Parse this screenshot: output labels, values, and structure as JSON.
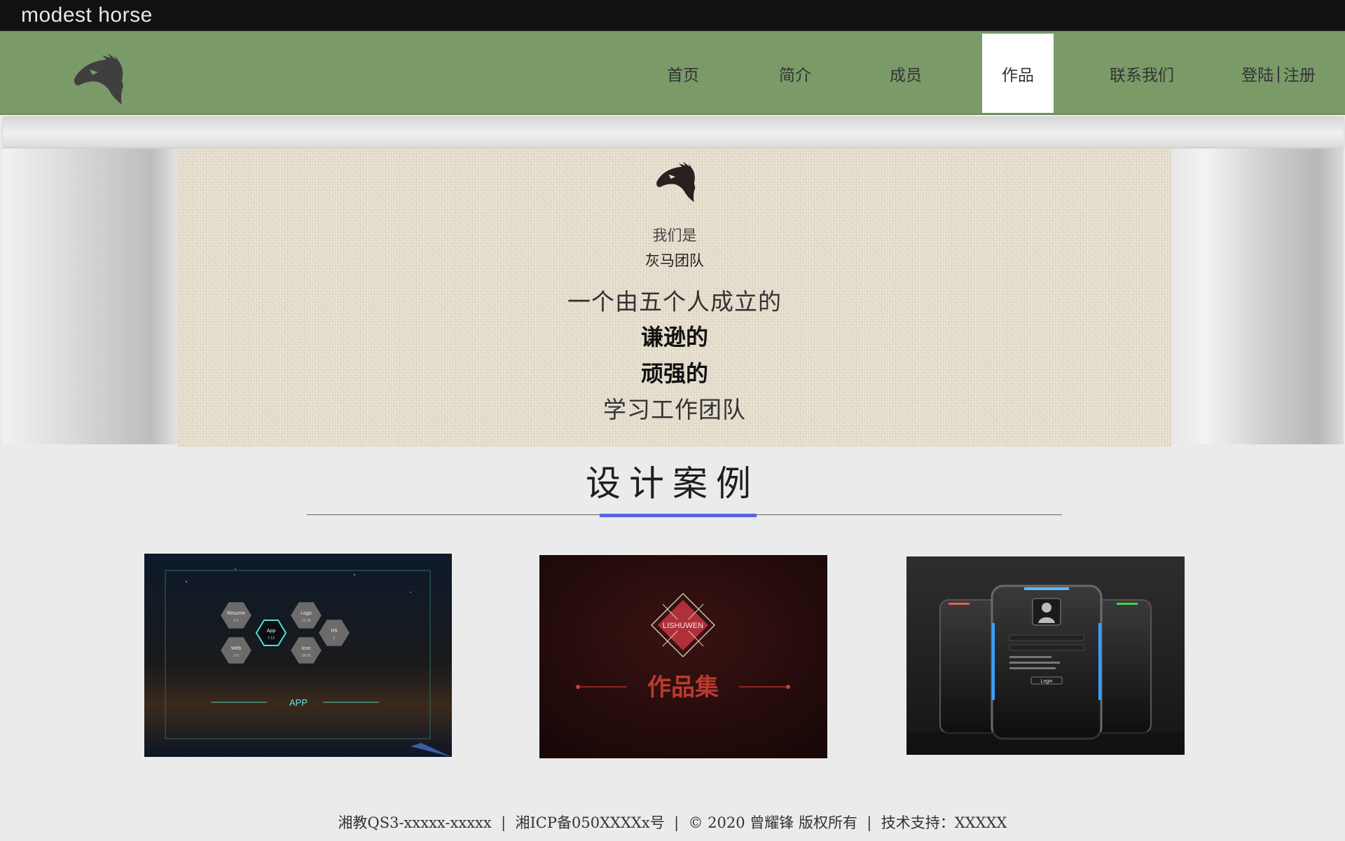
{
  "topbar": {
    "site_name": "modest horse"
  },
  "nav": {
    "logo_icon": "horse-head-icon",
    "items": [
      {
        "label": "首页"
      },
      {
        "label": "简介"
      },
      {
        "label": "成员"
      },
      {
        "label": "作品",
        "active": true
      },
      {
        "label": "联系我们"
      }
    ],
    "login_label": "登陆",
    "separator": "|",
    "register_label": "注册"
  },
  "hero": {
    "logo_icon": "horse-head-icon",
    "line1": "我们是",
    "line2": "灰马团队",
    "line3": "一个由五个人成立的",
    "line4": "谦逊的",
    "line5": "顽强的",
    "line6": "学习工作团队"
  },
  "section": {
    "title": "设计案例",
    "accent_color": "#5b63e0"
  },
  "cases": [
    {
      "hexagons": [
        {
          "title": "Resume",
          "sub": "2-4"
        },
        {
          "title": "Logo",
          "sub": "12-18"
        },
        {
          "title": "App",
          "sub": "7-12"
        },
        {
          "title": "H5",
          "sub": "2"
        },
        {
          "title": "Web",
          "sub": "2-6"
        },
        {
          "title": "Icon",
          "sub": "18-20"
        }
      ],
      "caption": "APP"
    },
    {
      "badge": "LISHUWEN",
      "caption": "作品集"
    },
    {
      "button": "Login"
    }
  ],
  "footer": {
    "text": "湘教QS3-xxxxx-xxxxx  |  湘ICP备050XXXXx号  |  © 2020 曾耀锋 版权所有  |  技术支持：XXXXX"
  },
  "colors": {
    "topbar": "#111111",
    "nav_green": "#7a9a68",
    "active_tab": "#ffffff",
    "hero_bg": "#e7dfcf"
  }
}
